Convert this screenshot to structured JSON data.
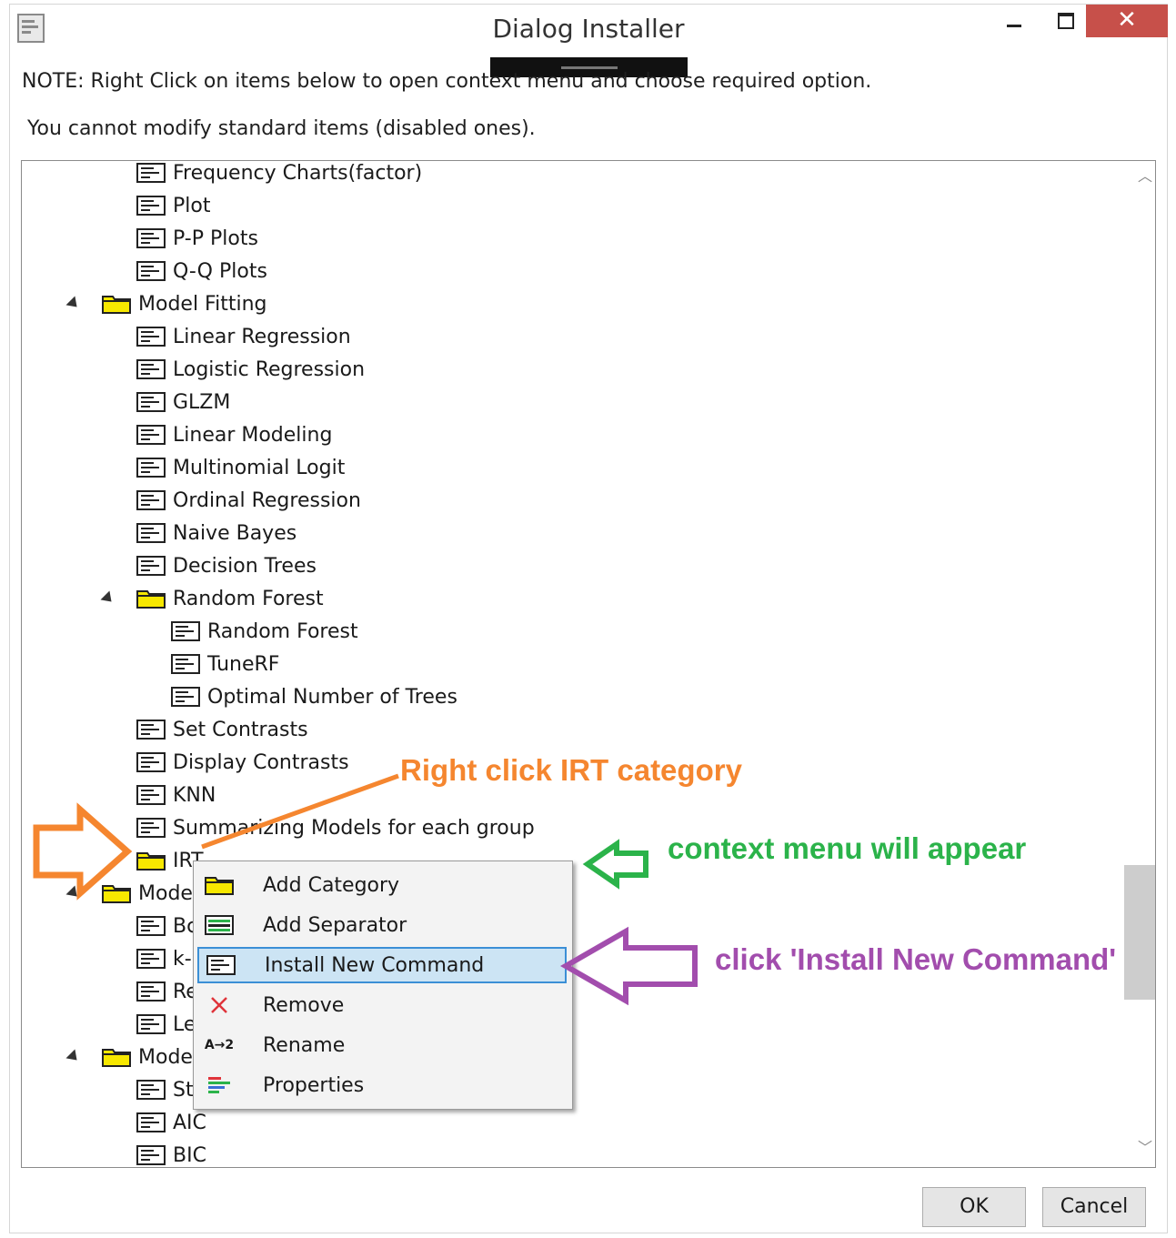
{
  "window": {
    "title": "Dialog Installer",
    "close_glyph": "✕"
  },
  "notes": {
    "line1": "NOTE: Right Click on items below to open context menu and choose required option.",
    "line2": "You cannot modify standard items (disabled ones)."
  },
  "tree": {
    "items": [
      {
        "label": "Frequency Charts(factor)",
        "type": "command",
        "level": 2
      },
      {
        "label": "Plot",
        "type": "command",
        "level": 2
      },
      {
        "label": "P-P Plots",
        "type": "command",
        "level": 2
      },
      {
        "label": "Q-Q Plots",
        "type": "command",
        "level": 2
      },
      {
        "label": "Model Fitting",
        "type": "category",
        "level": 1,
        "expanded": true
      },
      {
        "label": "Linear Regression",
        "type": "command",
        "level": 2
      },
      {
        "label": "Logistic Regression",
        "type": "command",
        "level": 2
      },
      {
        "label": "GLZM",
        "type": "command",
        "level": 2
      },
      {
        "label": "Linear Modeling",
        "type": "command",
        "level": 2
      },
      {
        "label": "Multinomial Logit",
        "type": "command",
        "level": 2
      },
      {
        "label": "Ordinal Regression",
        "type": "command",
        "level": 2
      },
      {
        "label": "Naive Bayes",
        "type": "command",
        "level": 2
      },
      {
        "label": "Decision Trees",
        "type": "command",
        "level": 2
      },
      {
        "label": "Random Forest",
        "type": "category",
        "level": 2,
        "expanded": true
      },
      {
        "label": "Random Forest",
        "type": "command",
        "level": 3
      },
      {
        "label": "TuneRF",
        "type": "command",
        "level": 3
      },
      {
        "label": "Optimal Number of Trees",
        "type": "command",
        "level": 3
      },
      {
        "label": "Set Contrasts",
        "type": "command",
        "level": 2
      },
      {
        "label": "Display Contrasts",
        "type": "command",
        "level": 2
      },
      {
        "label": "KNN",
        "type": "command",
        "level": 2
      },
      {
        "label": "Summarizing Models for each group",
        "type": "command",
        "level": 2
      },
      {
        "label": "IRT",
        "type": "category",
        "level": 2
      },
      {
        "label": "Mode",
        "type": "category",
        "level": 1,
        "expanded": true
      },
      {
        "label": "Bc",
        "type": "command",
        "level": 2
      },
      {
        "label": "k-",
        "type": "command",
        "level": 2
      },
      {
        "label": "Re",
        "type": "command",
        "level": 2
      },
      {
        "label": "Le",
        "type": "command",
        "level": 2
      },
      {
        "label": "Mode",
        "type": "category",
        "level": 1,
        "expanded": true
      },
      {
        "label": "St",
        "type": "command",
        "level": 2
      },
      {
        "label": "AIC",
        "type": "command",
        "level": 2
      },
      {
        "label": "BIC",
        "type": "command",
        "level": 2
      }
    ]
  },
  "context_menu": {
    "items": [
      {
        "label": "Add Category",
        "icon": "folder-icon"
      },
      {
        "label": "Add Separator",
        "icon": "separator-icon"
      },
      {
        "label": "Install New Command",
        "icon": "command-icon",
        "highlighted": true
      },
      {
        "label": "Remove",
        "icon": "remove-x-icon"
      },
      {
        "label": "Rename",
        "icon": "rename-icon",
        "icon_text": "A→2"
      },
      {
        "label": "Properties",
        "icon": "properties-icon"
      }
    ]
  },
  "annotations": {
    "orange": "Right click IRT category",
    "green": "context menu will appear",
    "purple": "click 'Install New Command'"
  },
  "buttons": {
    "ok": "OK",
    "cancel": "Cancel"
  },
  "colors": {
    "orange": "#f5862f",
    "green": "#2bb34a",
    "purple": "#a24dad",
    "highlight": "#cce4f4",
    "close": "#c7504a",
    "folder": "#f7e800"
  }
}
